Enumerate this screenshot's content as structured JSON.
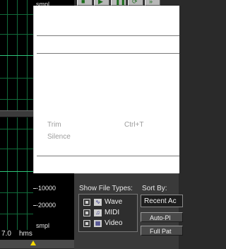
{
  "waveform": {
    "top_ruler_label": "smpl",
    "bottom_ruler_time": "7.0",
    "bottom_ruler_unit": "hms"
  },
  "vertical_ruler": {
    "top_label": "smpl",
    "labels": [
      "-10000",
      "-20000"
    ],
    "bottom_label": "smpl"
  },
  "toolbar": {
    "buttons": [
      "stop",
      "play",
      "pause",
      "loop",
      "skip"
    ]
  },
  "context_menu": {
    "items": [
      {
        "label": "Trim",
        "shortcut": "Ctrl+T",
        "enabled": false
      },
      {
        "label": "Silence",
        "shortcut": "",
        "enabled": false
      }
    ]
  },
  "organizer": {
    "show_file_types_label": "Show File Types:",
    "sort_by_label": "Sort By:",
    "file_types": [
      {
        "label": "Wave",
        "icon": "wave-icon"
      },
      {
        "label": "MIDI",
        "icon": "midi-icon"
      },
      {
        "label": "Video",
        "icon": "video-icon"
      }
    ],
    "sort_value": "Recent Ac",
    "auto_play_label": "Auto-Pl",
    "full_path_label": "Full Pat"
  },
  "colors": {
    "grid_line": "#116b3a",
    "center_line": "#2fc47b",
    "marker": "#f4d800"
  }
}
